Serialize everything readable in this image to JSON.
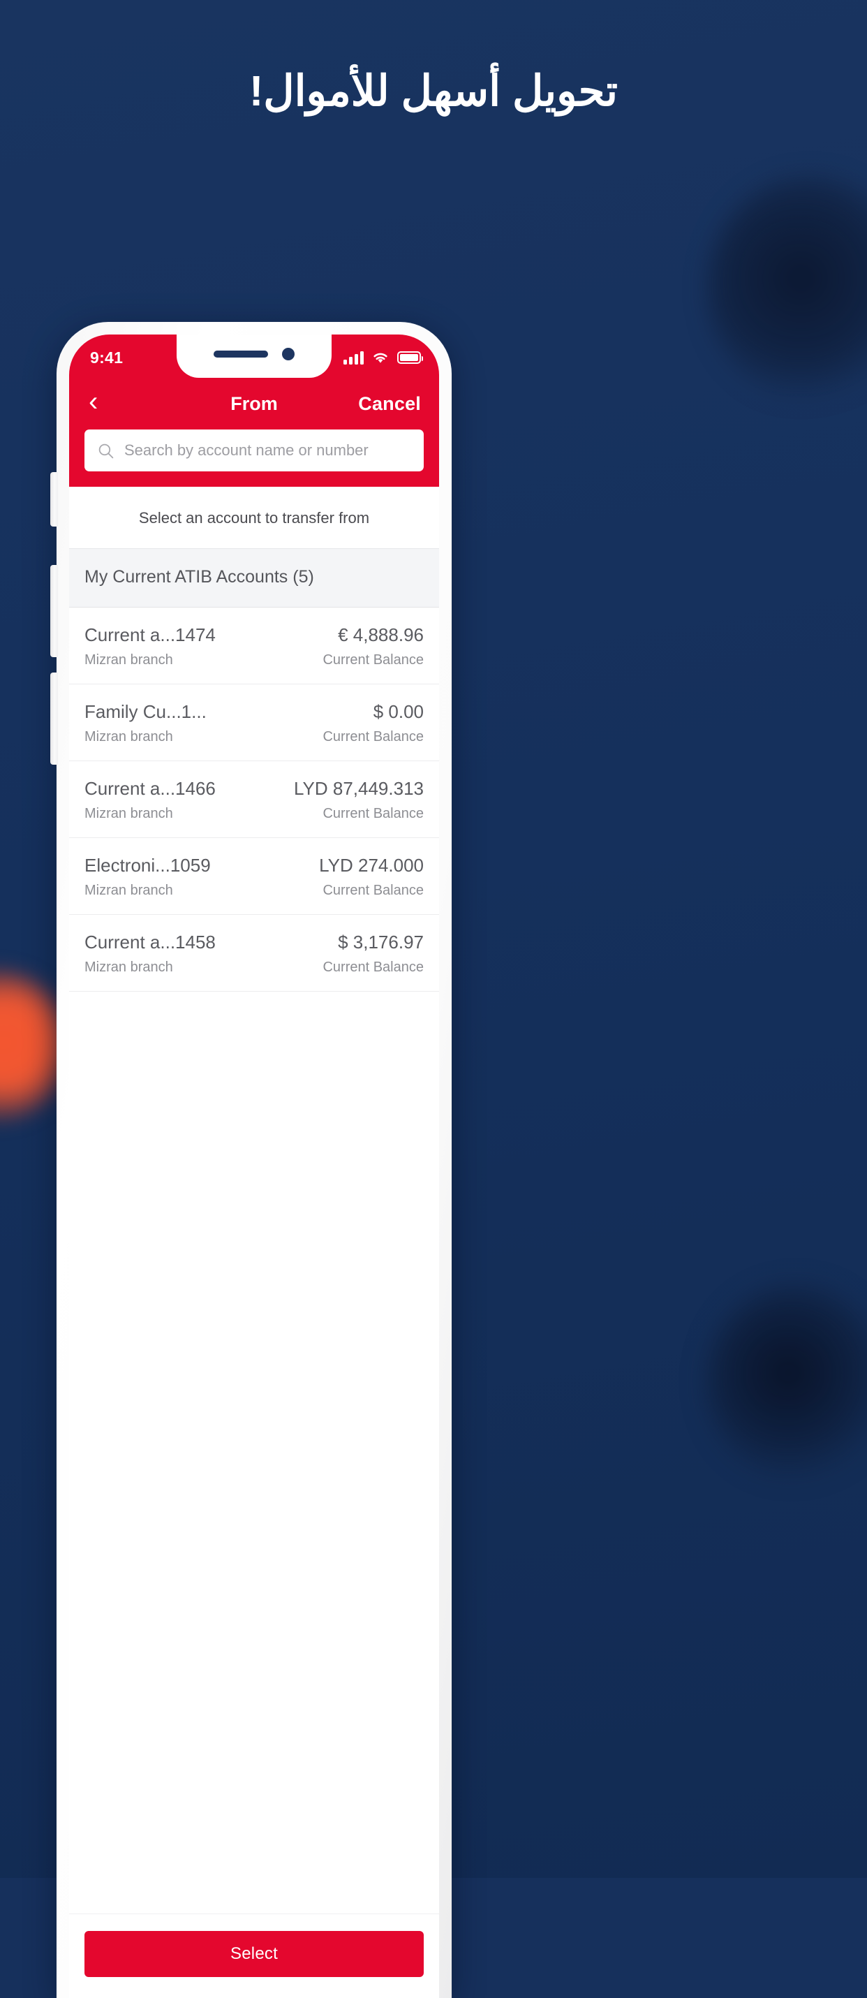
{
  "promo": {
    "headline": "تحويل أسهل للأموال!",
    "background_color": "#16305c",
    "accent_color": "#e4072e"
  },
  "phone": {
    "status_bar": {
      "time": "9:41",
      "signal_icon": "cellular-signal-icon",
      "wifi_icon": "wifi-icon",
      "battery_icon": "battery-full-icon"
    },
    "nav": {
      "back_icon": "back-chevron-icon",
      "title": "From",
      "cancel_label": "Cancel"
    },
    "search": {
      "icon": "search-icon",
      "placeholder": "Search by account name or number",
      "value": ""
    },
    "subtitle": "Select an account to transfer from",
    "group_header": "My Current ATIB Accounts (5)",
    "accounts": [
      {
        "name": "Current a...1474",
        "branch": "Mizran branch",
        "balance": "€ 4,888.96",
        "balance_label": "Current Balance"
      },
      {
        "name": "Family Cu...1...",
        "branch": "Mizran branch",
        "balance": "$ 0.00",
        "balance_label": "Current Balance"
      },
      {
        "name": "Current a...1466",
        "branch": "Mizran branch",
        "balance": "LYD 87,449.313",
        "balance_label": "Current Balance"
      },
      {
        "name": "Electroni...1059",
        "branch": "Mizran branch",
        "balance": "LYD 274.000",
        "balance_label": "Current Balance"
      },
      {
        "name": "Current a...1458",
        "branch": "Mizran branch",
        "balance": "$ 3,176.97",
        "balance_label": "Current Balance"
      }
    ],
    "footer": {
      "select_label": "Select"
    }
  }
}
